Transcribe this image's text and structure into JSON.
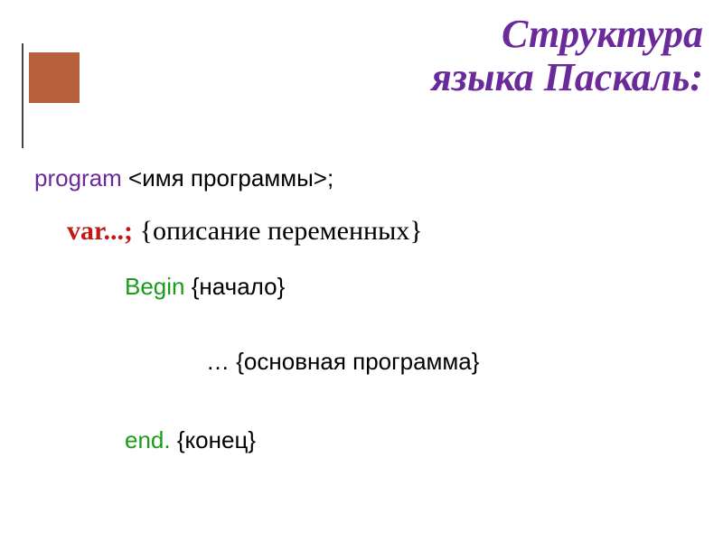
{
  "title": {
    "line1": "Структура",
    "line2": "языка Паскаль:"
  },
  "code": {
    "program_kw": "program",
    "program_rest": " <имя программы>;",
    "var_kw": "var...;",
    "var_comment": " {описание переменных}",
    "begin_kw": "Begin",
    "begin_comment": " {начало}",
    "body_ellipsis": "…  ",
    "body_comment": "{основная программа}",
    "end_kw": "end.",
    "end_comment": " {конец}"
  }
}
